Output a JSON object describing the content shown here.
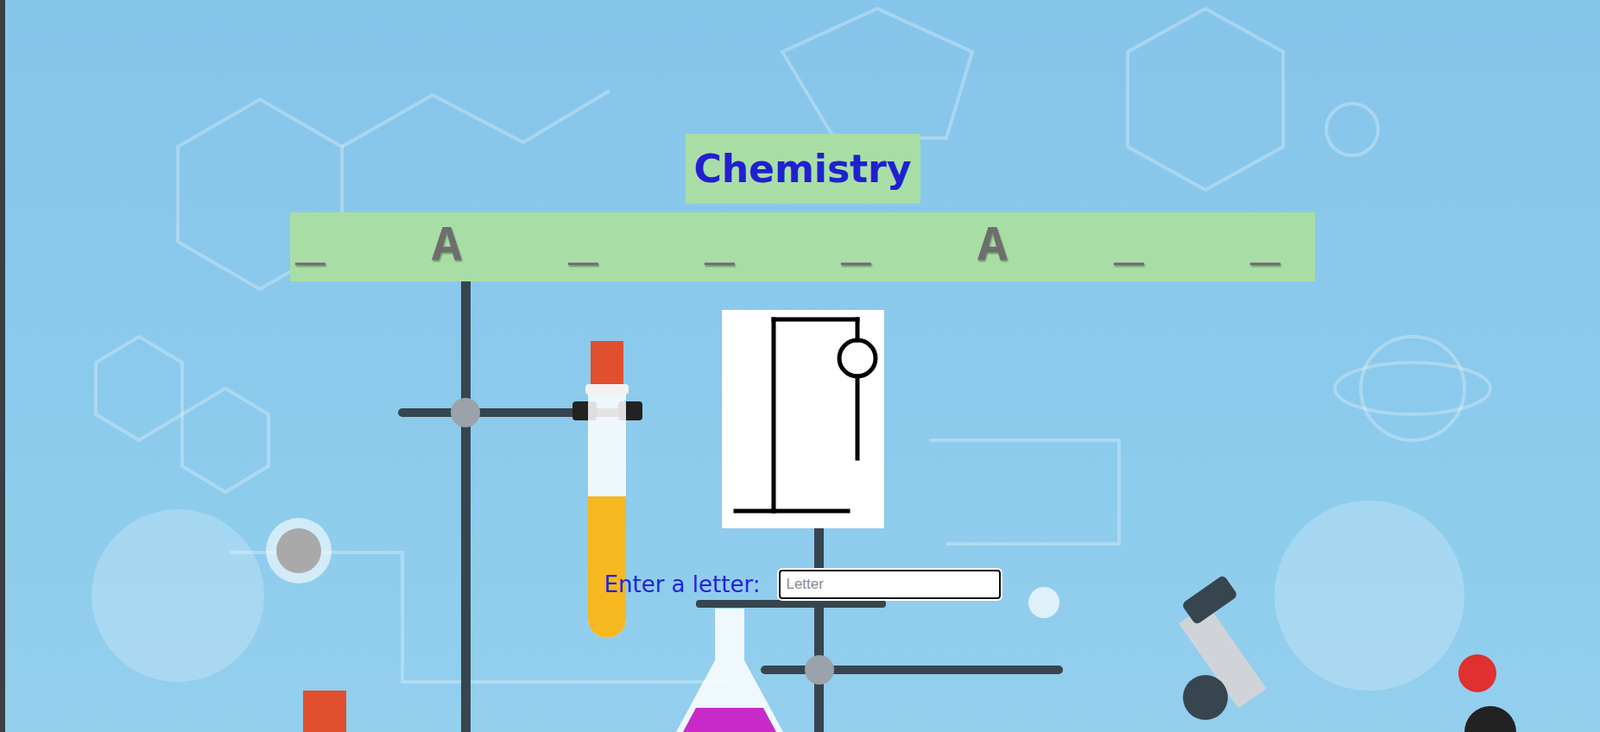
{
  "title": "Chemistry",
  "word": [
    {
      "text": "_"
    },
    {
      "text": "A"
    },
    {
      "text": "_"
    },
    {
      "text": "_"
    },
    {
      "text": "_"
    },
    {
      "text": "A"
    },
    {
      "text": "_"
    },
    {
      "text": "_"
    }
  ],
  "hangman": {
    "stage": 2
  },
  "input": {
    "label": "Enter a letter:",
    "placeholder": "Letter"
  }
}
